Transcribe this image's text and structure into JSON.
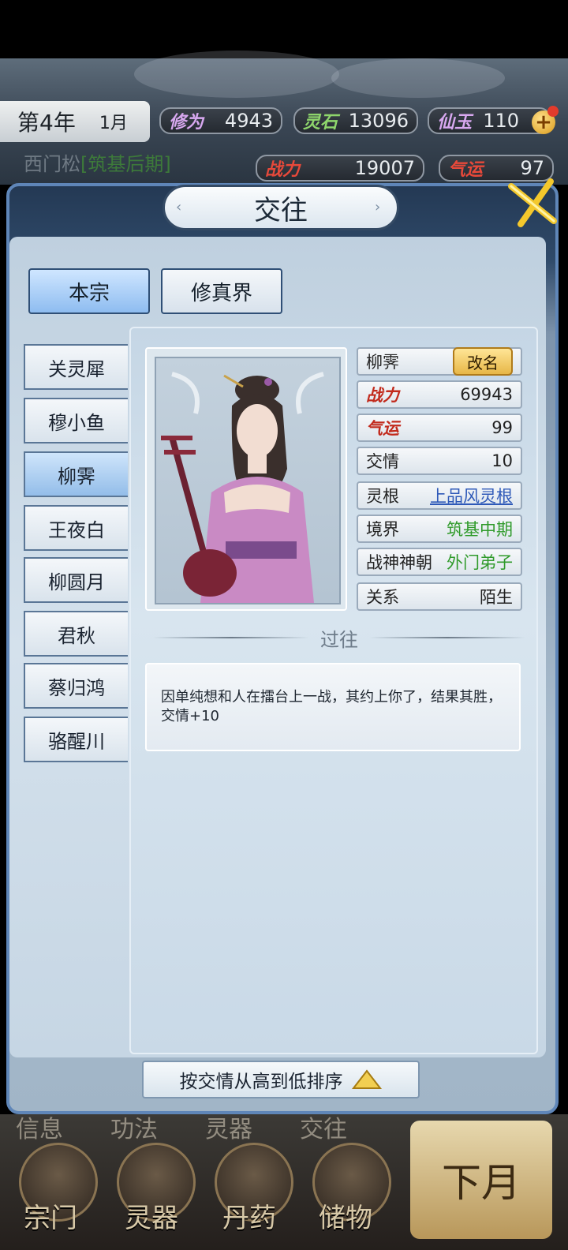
{
  "status": {
    "year": "第4年",
    "month": "1月",
    "resources": [
      {
        "label": "修为",
        "value": "4943",
        "color": "#d8a8f0"
      },
      {
        "label": "灵石",
        "value": "13096",
        "color": "#8ed66c"
      },
      {
        "label": "仙玉",
        "value": "110",
        "color": "#d8a8f0"
      }
    ],
    "player_name": "西门松",
    "player_realm": "[筑基后期]",
    "power": {
      "label": "战力",
      "value": "19007",
      "color": "#e8493a"
    },
    "luck": {
      "label": "气运",
      "value": "97",
      "color": "#e8493a"
    }
  },
  "dialog": {
    "title": "交往",
    "tabs": [
      {
        "label": "本宗",
        "active": true
      },
      {
        "label": "修真界",
        "active": false
      }
    ],
    "characters": [
      {
        "name": "关灵犀",
        "active": false
      },
      {
        "name": "穆小鱼",
        "active": false
      },
      {
        "name": "柳霁",
        "active": true
      },
      {
        "name": "王夜白",
        "active": false
      },
      {
        "name": "柳圆月",
        "active": false
      },
      {
        "name": "君秋",
        "active": false
      },
      {
        "name": "蔡归鸿",
        "active": false
      },
      {
        "name": "骆醒川",
        "active": false
      }
    ],
    "detail": {
      "name": "柳霁",
      "rename_label": "改名",
      "stats": [
        {
          "label": "战力",
          "value": "69943",
          "styled": true,
          "value_color": "#222222"
        },
        {
          "label": "气运",
          "value": "99",
          "styled": true,
          "value_color": "#222222"
        },
        {
          "label": "交情",
          "value": "10",
          "styled": false,
          "value_color": "#222222"
        },
        {
          "label": "灵根",
          "value": "上品风灵根",
          "styled": false,
          "value_color": "#2e59b8"
        },
        {
          "label": "境界",
          "value": "筑基中期",
          "styled": false,
          "value_color": "#2f9a2a"
        },
        {
          "label": "战神神朝",
          "value": "外门弟子",
          "styled": false,
          "value_color": "#2f9a2a"
        },
        {
          "label": "关系",
          "value": "陌生",
          "styled": false,
          "value_color": "#222222"
        }
      ],
      "history_title": "过往",
      "history": [
        "因单纯想和人在擂台上一战，其约上你了，结果其胜，交情+10"
      ]
    },
    "sort_label": "按交情从高到低排序"
  },
  "bottom_nav": {
    "faded_labels": [
      "信息",
      "功法",
      "灵器",
      "交往"
    ],
    "items": [
      "宗门",
      "灵器",
      "丹药",
      "储物"
    ],
    "next_month": "下月"
  }
}
